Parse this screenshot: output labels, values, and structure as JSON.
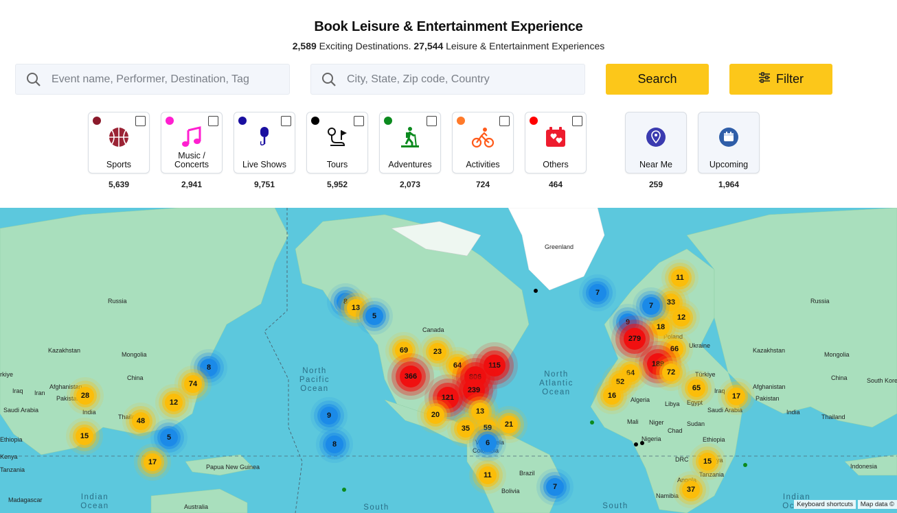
{
  "header": {
    "title": "Book Leisure & Entertainment Experience",
    "dest_count": "2,589",
    "dest_label": "Exciting Destinations.",
    "exp_count": "27,544",
    "exp_label": "Leisure & Entertainment Experiences"
  },
  "search": {
    "event_placeholder": "Event name, Performer, Destination, Tag",
    "location_placeholder": "City, State, Zip code, Country",
    "search_label": "Search",
    "filter_label": "Filter"
  },
  "colors": {
    "accent": "#fcc71a",
    "map_water": "#5cc8dd"
  },
  "categories": [
    {
      "label": "Sports",
      "count": "5,639",
      "dot": "#8b1a2b",
      "icon": "basketball-icon"
    },
    {
      "label": "Music / Concerts",
      "count": "2,941",
      "dot": "#ff1fd0",
      "icon": "music-note-icon"
    },
    {
      "label": "Live Shows",
      "count": "9,751",
      "dot": "#1a0fa0",
      "icon": "microphone-icon"
    },
    {
      "label": "Tours",
      "count": "5,952",
      "dot": "#000000",
      "icon": "route-flag-icon"
    },
    {
      "label": "Adventures",
      "count": "2,073",
      "dot": "#0b8a1e",
      "icon": "hiker-icon"
    },
    {
      "label": "Activities",
      "count": "724",
      "dot": "#ff7a2a",
      "icon": "cyclist-icon"
    },
    {
      "label": "Others",
      "count": "464",
      "dot": "#ff0000",
      "icon": "calendar-hearts-icon"
    }
  ],
  "quick": [
    {
      "label": "Near Me",
      "count": "259",
      "icon": "location-pin-icon"
    },
    {
      "label": "Upcoming",
      "count": "1,964",
      "icon": "calendar-icon"
    }
  ],
  "map": {
    "labels": [
      "Greenland",
      "Russia",
      "Russia",
      "Kazakhstan",
      "Mongolia",
      "China",
      "Kazakhstan",
      "Mongolia",
      "China",
      "Canada",
      "Iraq",
      "Iran",
      "Afghanistan",
      "Pakistan",
      "India",
      "Saudi Arabia",
      "Thailand",
      "Ethiopia",
      "Kenya",
      "Tanzania",
      "Madagascar",
      "Australia",
      "Papua New Guinea",
      "Ukraine",
      "Poland",
      "Türkiye",
      "Algeria",
      "Libya",
      "Egypt",
      "Mali",
      "Niger",
      "Chad",
      "Sudan",
      "Nigeria",
      "Ethiopia",
      "DRC",
      "Angola",
      "Namibia",
      "Kenya",
      "Tanzania",
      "Indonesia",
      "Brazil",
      "Bolivia",
      "Venezuela",
      "Colombia",
      "Iraq",
      "Afghanistan",
      "Pakistan",
      "India",
      "Saudi Arabia",
      "Thailand",
      "South Korea",
      "rkiye"
    ],
    "oceans": [
      "North Pacific Ocean",
      "North Atlantic Ocean",
      "Indian Ocean",
      "Indian Ocean",
      "South",
      "South"
    ],
    "clusters": [
      {
        "n": "11",
        "c": "y"
      },
      {
        "n": "33",
        "c": "y"
      },
      {
        "n": "12",
        "c": "y"
      },
      {
        "n": "18",
        "c": "y"
      },
      {
        "n": "7",
        "c": "b"
      },
      {
        "n": "9",
        "c": "b"
      },
      {
        "n": "279",
        "c": "r"
      },
      {
        "n": "66",
        "c": "y"
      },
      {
        "n": "189",
        "c": "r"
      },
      {
        "n": "72",
        "c": "y"
      },
      {
        "n": "64",
        "c": "y"
      },
      {
        "n": "52",
        "c": "y"
      },
      {
        "n": "16",
        "c": "y"
      },
      {
        "n": "65",
        "c": "y"
      },
      {
        "n": "17",
        "c": "y"
      },
      {
        "n": "15",
        "c": "y"
      },
      {
        "n": "37",
        "c": "y"
      },
      {
        "n": "7",
        "c": "b"
      },
      {
        "n": "8",
        "c": "b"
      },
      {
        "n": "13",
        "c": "y"
      },
      {
        "n": "5",
        "c": "b"
      },
      {
        "n": "69",
        "c": "y"
      },
      {
        "n": "23",
        "c": "y"
      },
      {
        "n": "64",
        "c": "y"
      },
      {
        "n": "115",
        "c": "r"
      },
      {
        "n": "366",
        "c": "r"
      },
      {
        "n": "806",
        "c": "r"
      },
      {
        "n": "239",
        "c": "r"
      },
      {
        "n": "121",
        "c": "r"
      },
      {
        "n": "20",
        "c": "y"
      },
      {
        "n": "13",
        "c": "y"
      },
      {
        "n": "35",
        "c": "y"
      },
      {
        "n": "59",
        "c": "y"
      },
      {
        "n": "21",
        "c": "y"
      },
      {
        "n": "6",
        "c": "b"
      },
      {
        "n": "11",
        "c": "y"
      },
      {
        "n": "7",
        "c": "b"
      },
      {
        "n": "9",
        "c": "b"
      },
      {
        "n": "8",
        "c": "b"
      },
      {
        "n": "8",
        "c": "b"
      },
      {
        "n": "74",
        "c": "y"
      },
      {
        "n": "12",
        "c": "y"
      },
      {
        "n": "28",
        "c": "y"
      },
      {
        "n": "48",
        "c": "y"
      },
      {
        "n": "5",
        "c": "b"
      },
      {
        "n": "15",
        "c": "y"
      },
      {
        "n": "17",
        "c": "y"
      }
    ],
    "keyboard_shortcuts": "Keyboard shortcuts",
    "map_data": "Map data ©"
  }
}
